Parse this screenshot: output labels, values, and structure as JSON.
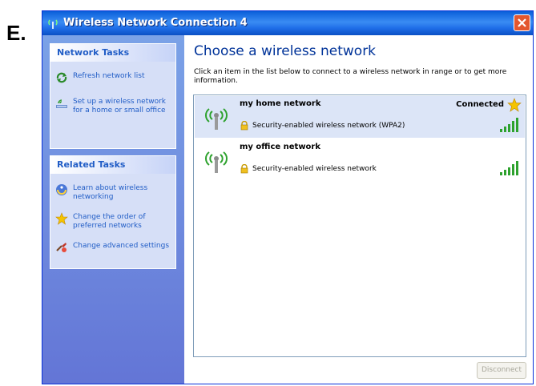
{
  "figure_label": "E.",
  "window": {
    "title": "Wireless Network Connection 4"
  },
  "sidebar": {
    "network_tasks": {
      "title": "Network Tasks",
      "items": [
        {
          "label": "Refresh network list",
          "icon": "refresh-icon"
        },
        {
          "label": "Set up a wireless network for a home or small office",
          "icon": "setup-network-icon"
        }
      ]
    },
    "related_tasks": {
      "title": "Related Tasks",
      "items": [
        {
          "label": "Learn about wireless networking",
          "icon": "help-icon"
        },
        {
          "label": "Change the order of preferred networks",
          "icon": "star-icon"
        },
        {
          "label": "Change advanced settings",
          "icon": "settings-icon"
        }
      ]
    }
  },
  "main": {
    "heading": "Choose a wireless network",
    "instructions": "Click an item in the list below to connect to a wireless network in range or to get more information.",
    "networks": [
      {
        "name": "my home network",
        "status": "Connected",
        "security": "Security-enabled wireless network (WPA2)",
        "signal": "excellent",
        "selected": true
      },
      {
        "name": "my office network",
        "status": "",
        "security": "Security-enabled wireless network",
        "signal": "excellent",
        "selected": false
      }
    ],
    "disconnect_label": "Disconnect"
  },
  "colors": {
    "title_bar": "#0a5fd9",
    "sidebar": "#7ba2e7",
    "heading": "#003399",
    "task_link": "#215dc6",
    "selected_row": "#dce5f7",
    "signal": "#2ea22e"
  }
}
